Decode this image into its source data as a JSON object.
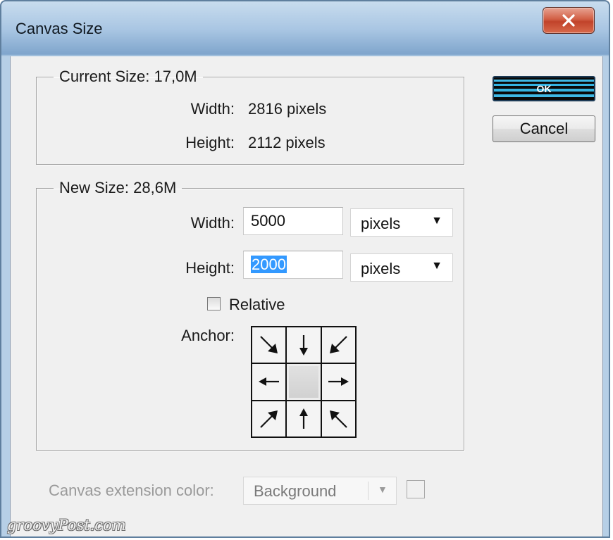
{
  "window": {
    "title": "Canvas Size"
  },
  "current_size": {
    "legend": "Current Size: 17,0M",
    "width_label": "Width:",
    "width_value": "2816 pixels",
    "height_label": "Height:",
    "height_value": "2112 pixels"
  },
  "new_size": {
    "legend": "New Size: 28,6M",
    "width_label": "Width:",
    "width_value": "5000",
    "width_unit": "pixels",
    "height_label": "Height:",
    "height_value": "2000",
    "height_unit": "pixels",
    "relative_label": "Relative",
    "relative_checked": false,
    "anchor_label": "Anchor:",
    "anchor_selected": "center"
  },
  "buttons": {
    "ok_label": "OK",
    "cancel_label": "Cancel"
  },
  "extension": {
    "label": "Canvas extension color:",
    "value": "Background"
  },
  "watermark": "groovyPost.com",
  "colors": {
    "selection": "#3399ff",
    "close_button": "#c1432a",
    "dialog_background": "#f0f0f0"
  }
}
